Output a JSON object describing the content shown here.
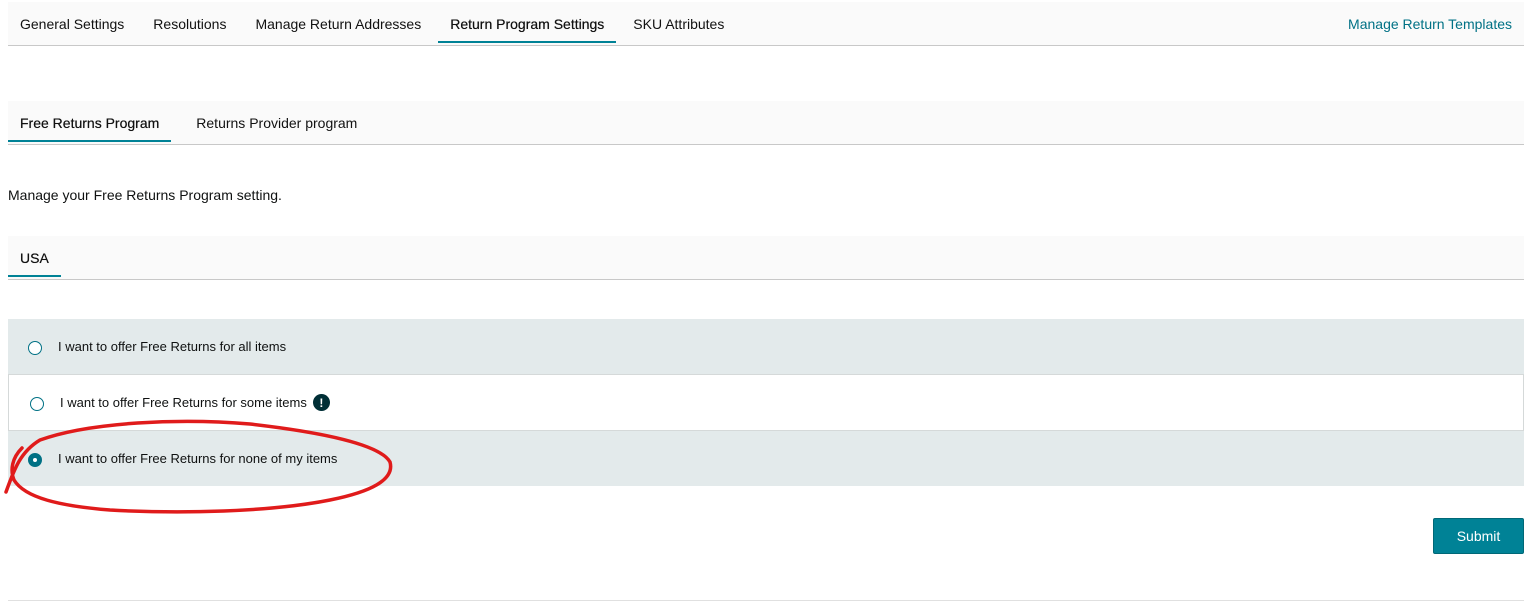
{
  "top_nav": {
    "tabs": [
      {
        "label": "General Settings"
      },
      {
        "label": "Resolutions"
      },
      {
        "label": "Manage Return Addresses"
      },
      {
        "label": "Return Program Settings"
      },
      {
        "label": "SKU Attributes"
      }
    ],
    "active_index": 3,
    "right_link": "Manage Return Templates"
  },
  "program_tabs": {
    "tabs": [
      {
        "label": "Free Returns Program"
      },
      {
        "label": "Returns Provider program"
      }
    ],
    "active_index": 0
  },
  "description": "Manage your Free Returns Program setting.",
  "country_tabs": {
    "tabs": [
      {
        "label": "USA"
      }
    ],
    "active_index": 0
  },
  "options": [
    {
      "label": "I want to offer Free Returns for all items",
      "selected": false
    },
    {
      "label": "I want to offer Free Returns for some items",
      "selected": false,
      "icon": "exclamation-icon",
      "icon_glyph": "!"
    },
    {
      "label": "I want to offer Free Returns for none of my items",
      "selected": true
    }
  ],
  "submit_label": "Submit",
  "colors": {
    "accent": "#008296",
    "link": "#007185",
    "annotation": "#e01b1b",
    "shaded_row": "#e3eaeb"
  }
}
